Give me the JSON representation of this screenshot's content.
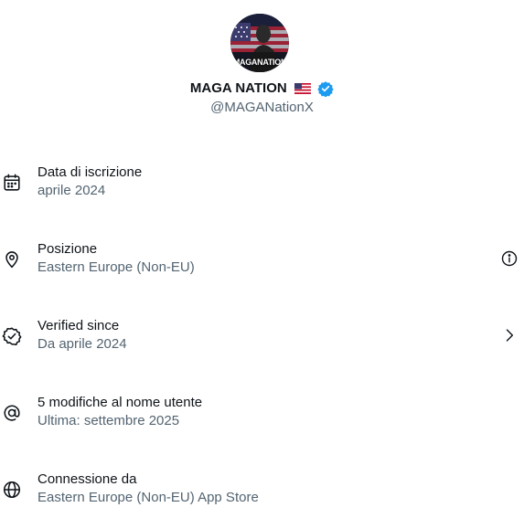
{
  "profile": {
    "display_name": "MAGA NATION",
    "flag_icon": "us-flag-icon",
    "badge_icon": "verified-badge-icon",
    "badge_color": "#1d9bf0",
    "handle": "@MAGANationX",
    "avatar_text": "MAGANATION"
  },
  "rows": [
    {
      "icon": "calendar-icon",
      "label": "Data di iscrizione",
      "value": "aprile 2024"
    },
    {
      "icon": "location-pin-icon",
      "label": "Posizione",
      "value": "Eastern Europe (Non-EU)",
      "trailing_icon": "info-icon"
    },
    {
      "icon": "verified-check-icon",
      "label": "Verified since",
      "value": "Da aprile 2024",
      "trailing_icon": "chevron-right-icon"
    },
    {
      "icon": "at-sign-icon",
      "label": "5 modifiche al nome utente",
      "value": "Ultima: settembre 2025"
    },
    {
      "icon": "globe-icon",
      "label": "Connessione da",
      "value": "Eastern Europe (Non-EU) App Store"
    }
  ],
  "colors": {
    "primary_text": "#0f1419",
    "secondary_text": "#536471",
    "background": "#ffffff"
  }
}
